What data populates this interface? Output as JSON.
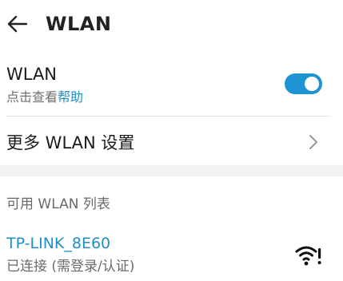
{
  "header": {
    "title": "WLAN",
    "back_icon": "arrow-left-icon"
  },
  "wlan": {
    "title": "WLAN",
    "subtitle_prefix": "点击查看",
    "help_link": "帮助",
    "enabled": true,
    "toggle_color": "#1e95d2"
  },
  "more_settings": {
    "label": "更多 WLAN 设置",
    "icon": "chevron-right-icon"
  },
  "available": {
    "header": "可用 WLAN 列表",
    "networks": [
      {
        "ssid": "TP-LINK_8E60",
        "status": "已连接 (需登录/认证)",
        "icon": "wifi-login-required-icon"
      }
    ]
  },
  "colors": {
    "accent": "#1f8fc4",
    "toggle_on": "#1e95d2"
  }
}
